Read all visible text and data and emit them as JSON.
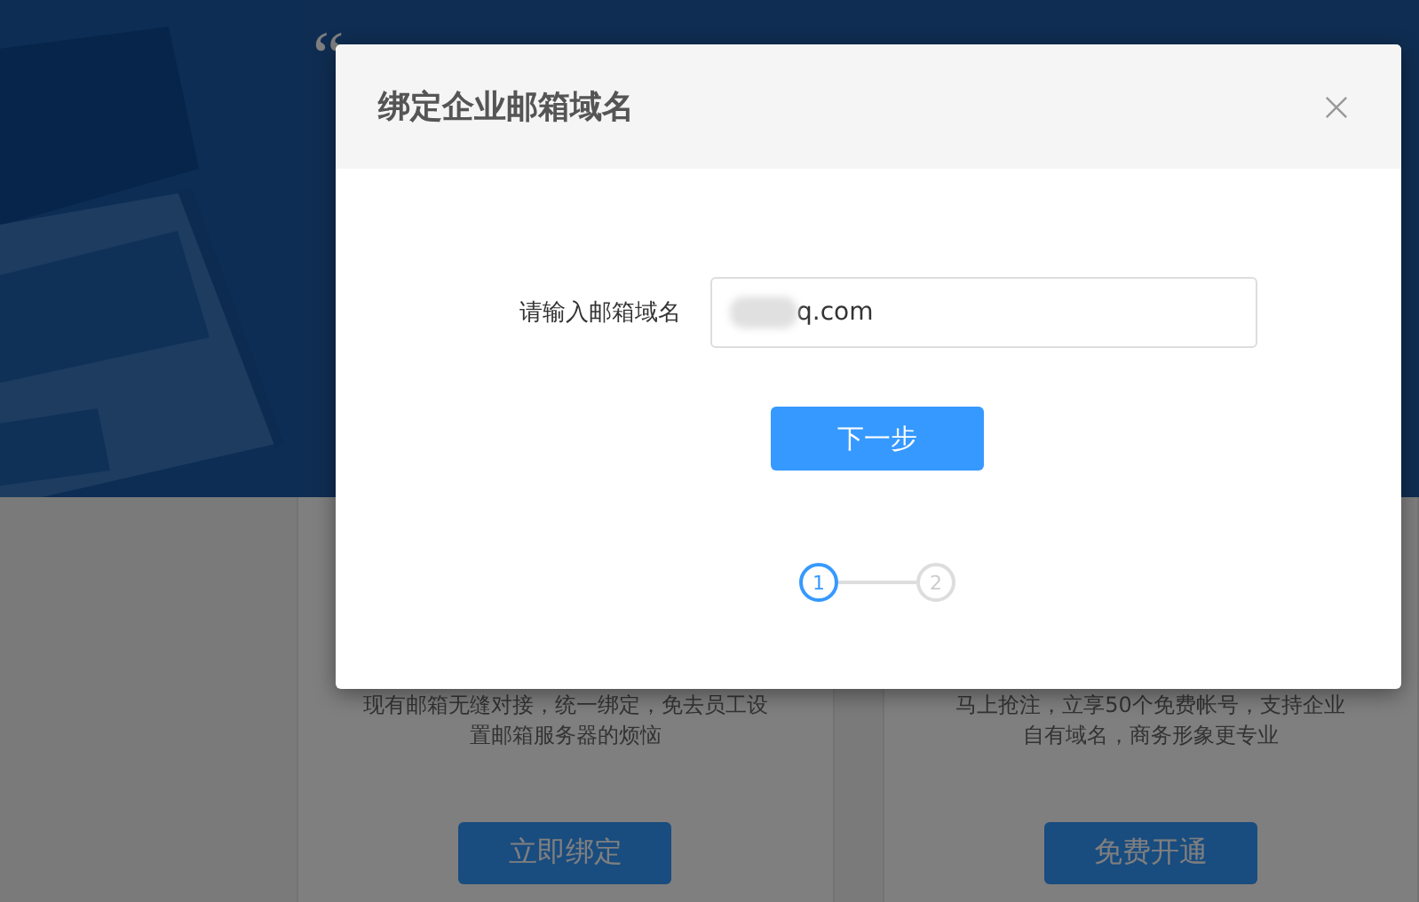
{
  "banner": {
    "quote_mark": "“"
  },
  "cards": [
    {
      "description": "现有邮箱无缝对接，统一绑定，免去员工设置邮箱服务器的烦恼",
      "button": "立即绑定"
    },
    {
      "description": "马上抢注，立享50个免费帐号，支持企业自有域名，商务形象更专业",
      "button": "免费开通"
    }
  ],
  "dialog": {
    "title": "绑定企业邮箱域名",
    "field": {
      "label": "请输入邮箱域名",
      "value": "q.com"
    },
    "next_button": "下一步",
    "steps": [
      {
        "number": "1",
        "selected": true
      },
      {
        "number": "2",
        "selected": false
      }
    ]
  }
}
